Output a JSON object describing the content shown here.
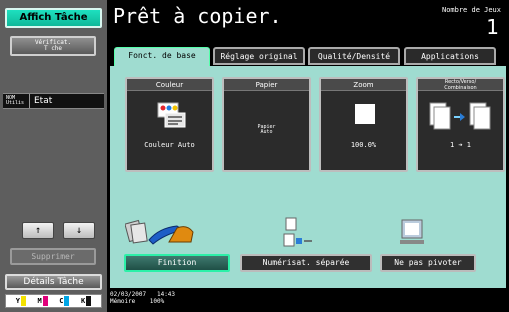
{
  "left_panel": {
    "job_display_button": "Affich Tâche",
    "verify_button": [
      "Vérificat.",
      "T che"
    ],
    "status_row": {
      "name_lines": [
        "NOM",
        "Utilis"
      ],
      "state_label": "Etat"
    },
    "scroll_up_glyph": "↑",
    "scroll_down_glyph": "↓",
    "delete_button": "Supprimer",
    "job_details_button": "Détails Tâche",
    "toner": [
      {
        "label": "Y",
        "color": "#f4e200"
      },
      {
        "label": "M",
        "color": "#e0007a"
      },
      {
        "label": "C",
        "color": "#00a6e6"
      },
      {
        "label": "K",
        "color": "#111111"
      }
    ]
  },
  "header": {
    "title": "Prêt à copier.",
    "copies_label": "Nombre de Jeux",
    "copies_value": "1"
  },
  "tabs": [
    {
      "label": "Fonct. de base",
      "active": true
    },
    {
      "label": "Réglage original",
      "active": false
    },
    {
      "label": "Qualité/Densité",
      "active": false
    },
    {
      "label": "Applications",
      "active": false
    }
  ],
  "cards": {
    "color": {
      "title": "Couleur",
      "value": "Couleur Auto"
    },
    "paper": {
      "title": "Papier",
      "value": [
        "Papier",
        "Auto"
      ]
    },
    "zoom": {
      "title": "Zoom",
      "value": "100.0%"
    },
    "duplex": {
      "title": [
        "Recto/Verso/",
        "Combinaison"
      ],
      "value": "1 ➔ 1"
    }
  },
  "function_buttons": {
    "finishing": "Finition",
    "separate_scan": "Numérisat. séparée",
    "no_rotate": "Ne pas pivoter"
  },
  "status": {
    "date": "02/03/2007",
    "time": "14:43",
    "memory_label": "Mémoire",
    "memory_value": "100%"
  }
}
